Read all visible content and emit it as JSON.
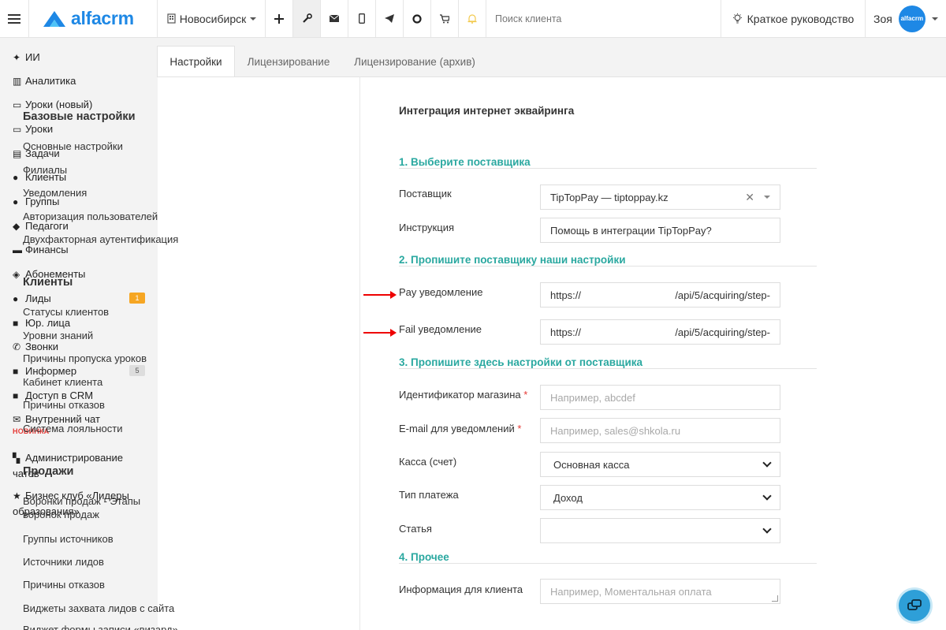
{
  "topbar": {
    "logo_text": "alfacrm",
    "branch": "Новосибирск",
    "icons": [
      "plus-icon",
      "wrench-icon",
      "mail-icon",
      "phone-icon",
      "telegram-icon",
      "circle-icon",
      "cart-icon",
      "bell-icon"
    ],
    "search_placeholder": "Поиск клиента",
    "guide_label": "Краткое руководство",
    "user_name": "Зоя",
    "avatar_text": "alfacrm"
  },
  "sidebar": {
    "items": [
      {
        "label": "ИИ",
        "icon": "sparkles-icon"
      },
      {
        "label": "Аналитика",
        "icon": "map-icon"
      },
      {
        "label": "Уроки (новый)",
        "icon": "calendar-icon"
      },
      {
        "label": "Уроки",
        "icon": "calendar-icon"
      },
      {
        "label": "Задачи",
        "icon": "clipboard-icon"
      },
      {
        "label": "Клиенты",
        "icon": "user-icon"
      },
      {
        "label": "Группы",
        "icon": "users-icon"
      },
      {
        "label": "Педагоги",
        "icon": "graduation-cap-icon"
      },
      {
        "label": "Финансы",
        "icon": "money-icon"
      },
      {
        "label": "Абонементы",
        "icon": "tag-icon"
      },
      {
        "label": "Лиды",
        "icon": "user-plus-icon",
        "badge": "1"
      },
      {
        "label": "Юр. лица",
        "icon": "briefcase-icon"
      },
      {
        "label": "Звонки",
        "icon": "phone-icon"
      },
      {
        "label": "Информер",
        "icon": "monitor-icon",
        "badge": "5"
      },
      {
        "label": "Доступ в CRM",
        "icon": "lock-icon"
      },
      {
        "label": "Внутренний чат",
        "icon": "envelope-icon",
        "tag": "НОВИНКА"
      },
      {
        "label": "Администрирование чатов",
        "icon": "grid-icon"
      },
      {
        "label": "Бизнес клуб «Лидеры образования»",
        "icon": "star-icon"
      }
    ]
  },
  "tabs": [
    "Настройки",
    "Лицензирование",
    "Лицензирование (архив)"
  ],
  "settings_menu": {
    "groups": [
      {
        "title": "Базовые настройки",
        "links": [
          "Основные настройки",
          "Филиалы",
          "Уведомления",
          "Авторизация пользователей",
          "Двухфакторная аутентификация"
        ]
      },
      {
        "title": "Клиенты",
        "links": [
          "Статусы клиентов",
          "Уровни знаний",
          "Причины пропуска уроков",
          "Кабинет клиента",
          "Причины отказов",
          "Система лояльности"
        ]
      },
      {
        "title": "Продажи",
        "links": [
          "Воронки продаж - Этапы воронок продаж",
          "Группы источников",
          "Источники лидов",
          "Причины отказов",
          "Виджеты захвата лидов с сайта",
          "Виджет формы записи «визард»"
        ]
      }
    ]
  },
  "form": {
    "title": "Интеграция интернет эквайринга",
    "sections": {
      "s1": "1. Выберите поставщика",
      "s2": "2. Пропишите поставщику наши настройки",
      "s3": "3. Пропишите здесь настройки от поставщика",
      "s4": "4. Прочее"
    },
    "provider": {
      "label": "Поставщик",
      "value": "TipTopPay — tiptoppay.kz"
    },
    "instruction": {
      "label": "Инструкция",
      "value": "Помощь в интеграции TipTopPay?"
    },
    "pay_notify": {
      "label": "Pay уведомление",
      "prefix": "https://",
      "suffix": "/api/5/acquiring/step-"
    },
    "fail_notify": {
      "label": "Fail уведомление",
      "prefix": "https://",
      "suffix": "/api/5/acquiring/step-"
    },
    "shop_id": {
      "label": "Идентификатор магазина",
      "required_mark": "*",
      "placeholder": "Например, abcdef"
    },
    "email": {
      "label": "E-mail для уведомлений",
      "required_mark": "*",
      "placeholder": "Например, sales@shkola.ru"
    },
    "cashbox": {
      "label": "Касса (счет)",
      "value": "Основная касса"
    },
    "payment_type": {
      "label": "Тип платежа",
      "value": "Доход"
    },
    "article": {
      "label": "Статья",
      "value": ""
    },
    "client_info": {
      "label": "Информация для клиента",
      "placeholder": "Например, Моментальная оплата"
    }
  },
  "colors": {
    "accent": "#2aa8a0",
    "brand": "#1e88e5",
    "badge_orange": "#f6a623",
    "arrow": "#e00000"
  }
}
